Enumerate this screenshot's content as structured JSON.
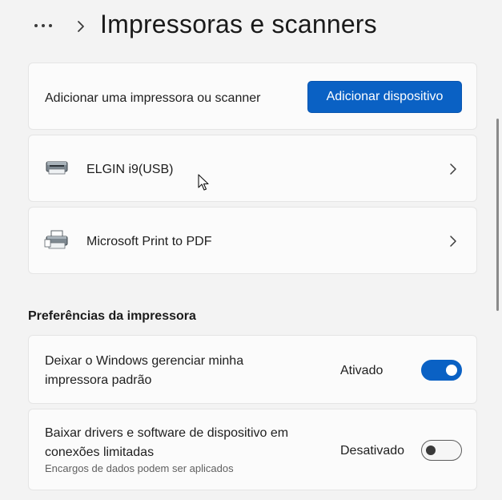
{
  "header": {
    "more_icon": "more-horizontal-icon",
    "chevron_icon": "chevron-right-icon",
    "title": "Impressoras e scanners"
  },
  "add_printer": {
    "label": "Adicionar uma impressora ou scanner",
    "button_label": "Adicionar dispositivo",
    "accent_color": "#0a61c4"
  },
  "devices": [
    {
      "name": "ELGIN i9(USB)",
      "icon": "printer-icon"
    },
    {
      "name": "Microsoft Print to PDF",
      "icon": "pdf-printer-icon"
    }
  ],
  "preferences": {
    "heading": "Preferências da impressora",
    "items": [
      {
        "label": "Deixar o Windows gerenciar minha impressora padrão",
        "state": "Ativado",
        "toggle_on": true
      },
      {
        "label": "Baixar drivers e software de dispositivo em conexões limitadas",
        "sublabel": "Encargos de dados podem ser aplicados",
        "state": "Desativado",
        "toggle_on": false
      }
    ]
  }
}
